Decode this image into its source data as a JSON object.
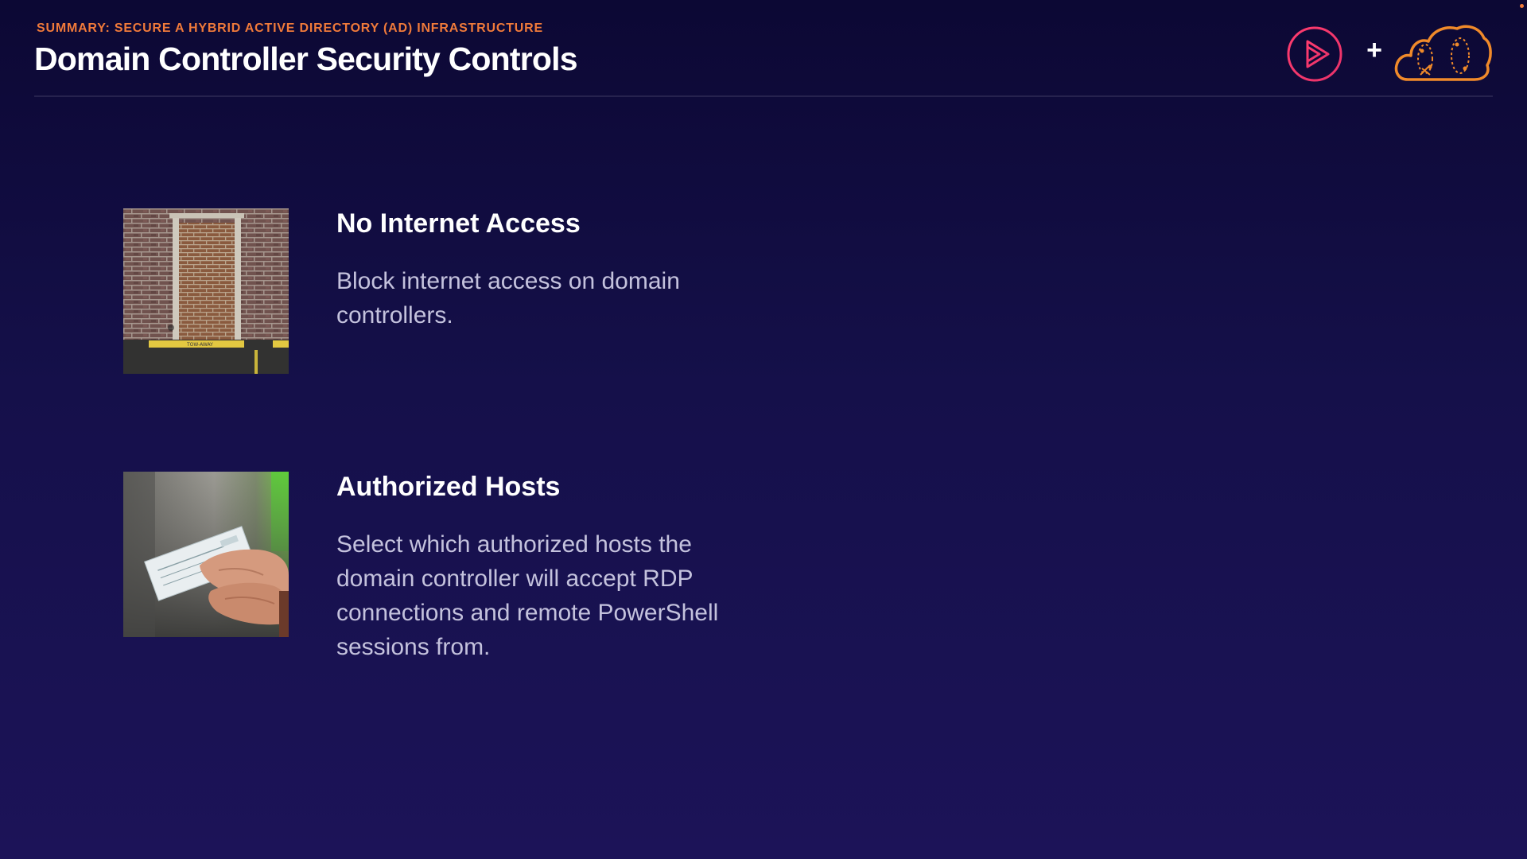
{
  "slide": {
    "eyebrow": "SUMMARY: SECURE A HYBRID ACTIVE DIRECTORY (AD) INFRASTRUCTURE",
    "title": "Domain Controller Security Controls",
    "plus_sign": "+",
    "accent_color": "#f07a3a"
  },
  "logos": {
    "left_icon": "pluralsight-play-logo-icon",
    "right_icon": "cloud-logo-icon"
  },
  "items": [
    {
      "title": "No Internet Access",
      "description": "Block internet access on domain controllers.",
      "image": "bricked-up-doorway-photo"
    },
    {
      "title": "Authorized Hosts",
      "description": "Select which authorized hosts the domain controller will accept RDP connections and remote PowerShell sessions from.",
      "image": "hands-holding-check-photo"
    }
  ]
}
